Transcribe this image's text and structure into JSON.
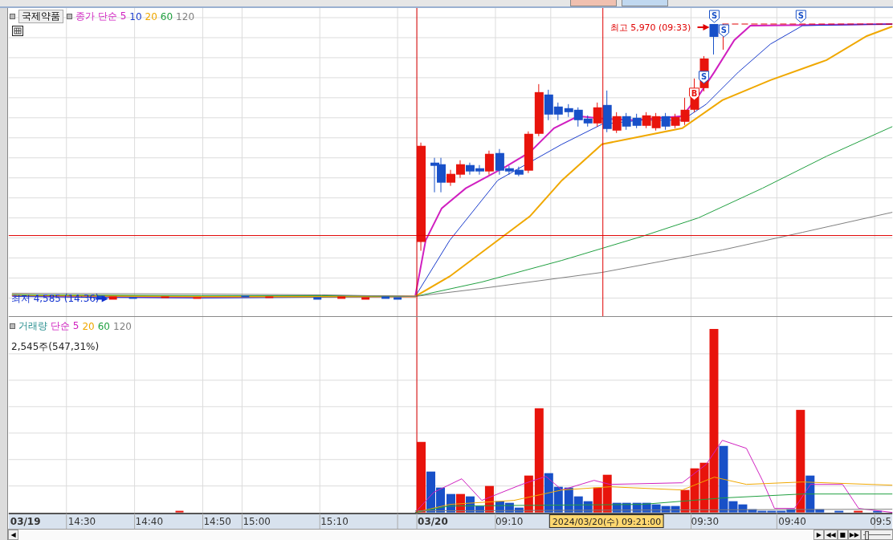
{
  "price_pane": {
    "title_button": "국제약품",
    "legend": [
      {
        "label": "종가 단순 5",
        "color": "#d020c0"
      },
      {
        "label": "10",
        "color": "#1a3ccc"
      },
      {
        "label": "20",
        "color": "#f0a800"
      },
      {
        "label": "60",
        "color": "#20a040"
      },
      {
        "label": "120",
        "color": "#808080"
      }
    ],
    "high_label": "최고 5,970 (09:33)",
    "low_label": "최저 4,585 (14:36)",
    "signals": [
      {
        "label": "S",
        "kind": "sell"
      },
      {
        "label": "S",
        "kind": "sell"
      },
      {
        "label": "S",
        "kind": "sell"
      },
      {
        "label": "S",
        "kind": "sell"
      },
      {
        "label": "B",
        "kind": "buy"
      }
    ]
  },
  "volume_pane": {
    "legend": [
      {
        "label": "거래량",
        "color": "#2a9090"
      },
      {
        "label": "단순 5",
        "color": "#d020c0"
      },
      {
        "label": "20",
        "color": "#f0a800"
      },
      {
        "label": "60",
        "color": "#20a040"
      },
      {
        "label": "120",
        "color": "#808080"
      }
    ],
    "reading": "2,545주(547,31%)"
  },
  "time_axis": {
    "labels": [
      {
        "text": "03/19",
        "kind": "date"
      },
      {
        "text": "14:30",
        "kind": "time"
      },
      {
        "text": "14:40",
        "kind": "time"
      },
      {
        "text": "14:50",
        "kind": "time"
      },
      {
        "text": "15:00",
        "kind": "time"
      },
      {
        "text": "15:10",
        "kind": "time"
      },
      {
        "text": "03/20",
        "kind": "date"
      },
      {
        "text": "09:10",
        "kind": "time"
      },
      {
        "text": "09:30",
        "kind": "time"
      },
      {
        "text": "09:40",
        "kind": "time"
      },
      {
        "text": "09:5",
        "kind": "time"
      }
    ],
    "cursor_label": "2024/03/20(수) 09:21:00"
  },
  "scroll_bar": {
    "left_button": "◀",
    "controls": [
      "▶",
      "◀◀",
      "■",
      "▶▶"
    ],
    "zoom_slider": {
      "level": 0.12
    }
  }
}
